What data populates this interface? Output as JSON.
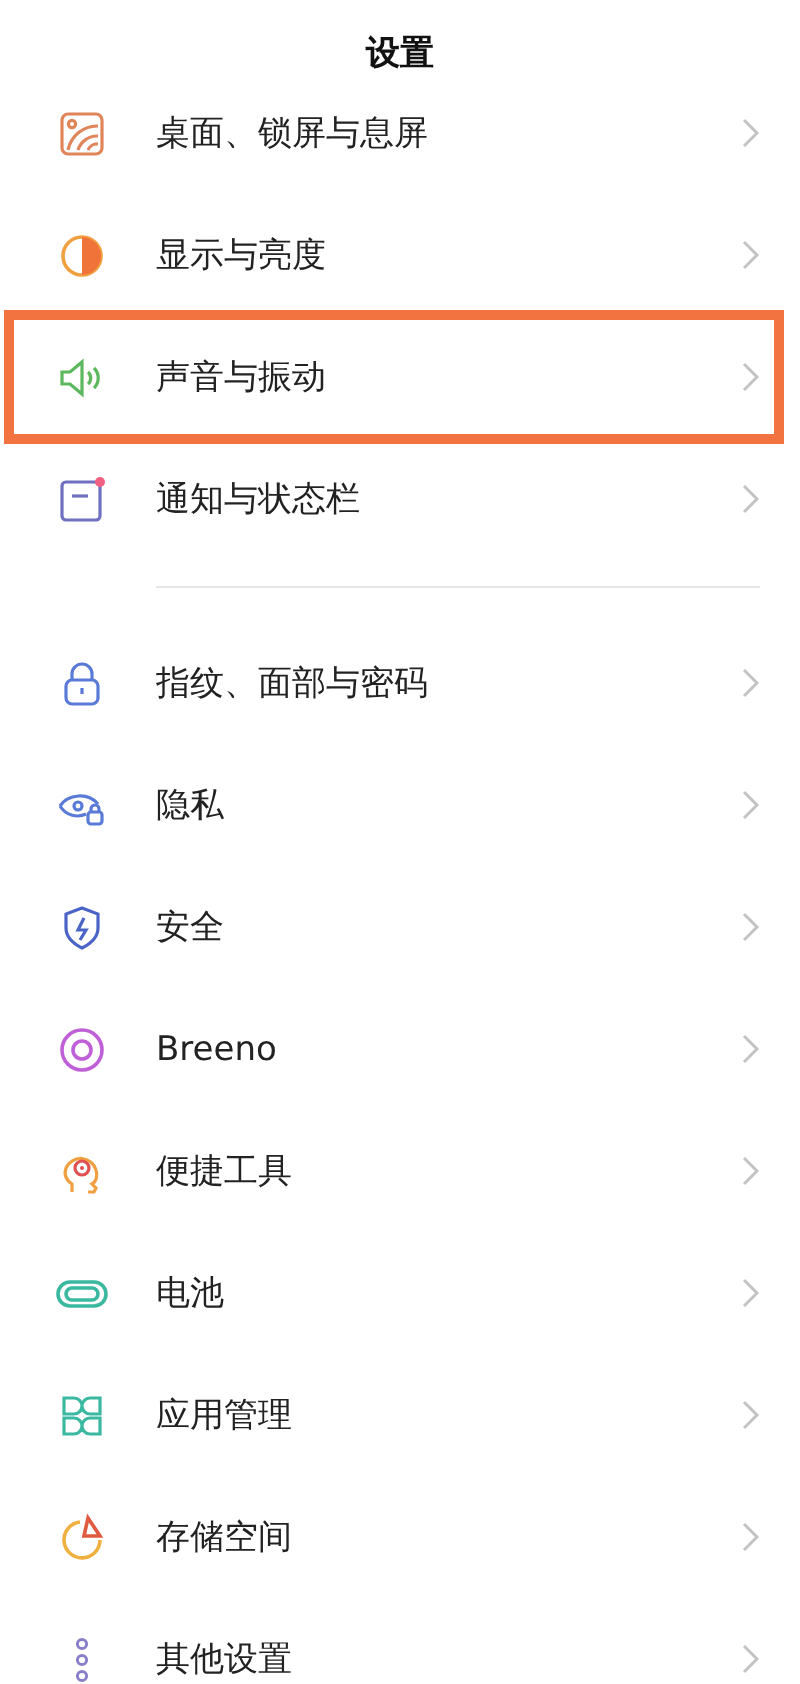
{
  "header": {
    "title": "设置"
  },
  "groups": [
    {
      "items": [
        {
          "label": "桌面、锁屏与息屏",
          "highlighted": false
        },
        {
          "label": "显示与亮度",
          "highlighted": false
        },
        {
          "label": "声音与振动",
          "highlighted": true
        },
        {
          "label": "通知与状态栏",
          "highlighted": false
        }
      ]
    },
    {
      "items": [
        {
          "label": "指纹、面部与密码",
          "highlighted": false
        },
        {
          "label": "隐私",
          "highlighted": false
        },
        {
          "label": "安全",
          "highlighted": false
        },
        {
          "label": "Breeno",
          "highlighted": false
        },
        {
          "label": "便捷工具",
          "highlighted": false
        },
        {
          "label": "电池",
          "highlighted": false
        },
        {
          "label": "应用管理",
          "highlighted": false
        },
        {
          "label": "存储空间",
          "highlighted": false
        },
        {
          "label": "其他设置",
          "highlighted": false
        }
      ]
    }
  ]
}
